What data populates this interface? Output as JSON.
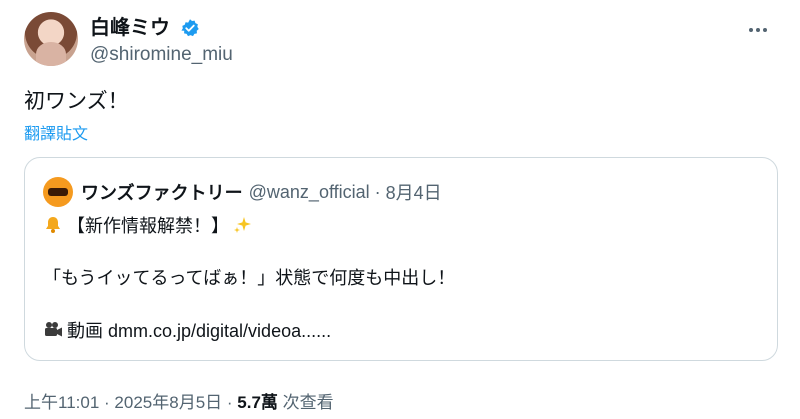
{
  "author": {
    "display_name": "白峰ミウ",
    "handle": "@shiromine_miu",
    "verified": true
  },
  "tweet": {
    "text": "初ワンズ！",
    "translate_label": "翻譯貼文"
  },
  "quote": {
    "author_name": "ワンズファクトリー",
    "author_handle": "@wanz_official",
    "separator": "·",
    "date": "8月4日",
    "line1": "【新作情報解禁！】",
    "line2": "「もうイッてるってばぁ！」状態で何度も中出し！",
    "line3": "動画 dmm.co.jp/digital/videoa......"
  },
  "meta": {
    "time": "上午11:01",
    "sep1": "·",
    "date": "2025年8月5日",
    "sep2": "·",
    "views": "5.7萬",
    "views_label": "次查看"
  },
  "icons": {
    "verified": "verified-badge-icon",
    "more": "more-options-icon",
    "bell": "bell-emoji",
    "sparkles": "sparkles-emoji",
    "camera": "movie-camera-emoji"
  },
  "colors": {
    "accent": "#1d9bf0",
    "secondary_text": "#536471",
    "border": "#cfd9de"
  }
}
